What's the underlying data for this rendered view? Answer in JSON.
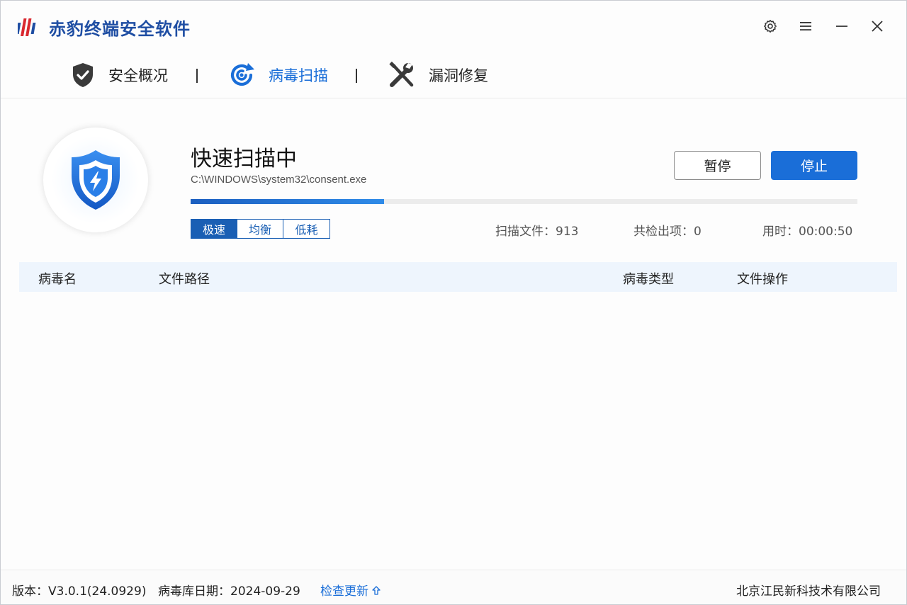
{
  "app": {
    "title": "赤豹终端安全软件"
  },
  "nav": {
    "items": [
      {
        "label": "安全概况",
        "icon": "shield-check-icon"
      },
      {
        "label": "病毒扫描",
        "icon": "radar-scan-icon",
        "active": true
      },
      {
        "label": "漏洞修复",
        "icon": "wrench-screwdriver-icon"
      }
    ],
    "separator": "|"
  },
  "scan": {
    "title": "快速扫描中",
    "current_file": "C:\\WINDOWS\\system32\\consent.exe",
    "progress": 0.29,
    "pause_label": "暂停",
    "stop_label": "停止",
    "speed_options": [
      "极速",
      "均衡",
      "低耗"
    ],
    "speed_selected": "极速",
    "stats": {
      "files_label": "扫描文件：",
      "files_value": "913",
      "detected_label": "共检出项：",
      "detected_value": "0",
      "time_label": "用时：",
      "time_value": "00:00:50"
    }
  },
  "table": {
    "columns": [
      "病毒名",
      "文件路径",
      "病毒类型",
      "文件操作"
    ],
    "rows": []
  },
  "footer": {
    "version": "版本：V3.0.1(24.0929)",
    "db_date": "病毒库日期：2024-09-29",
    "update_link": "检查更新",
    "company": "北京江民新科技术有限公司"
  },
  "colors": {
    "accent": "#1a6ed8",
    "brand": "#1f4ea3",
    "logo_red": "#d9282f"
  }
}
